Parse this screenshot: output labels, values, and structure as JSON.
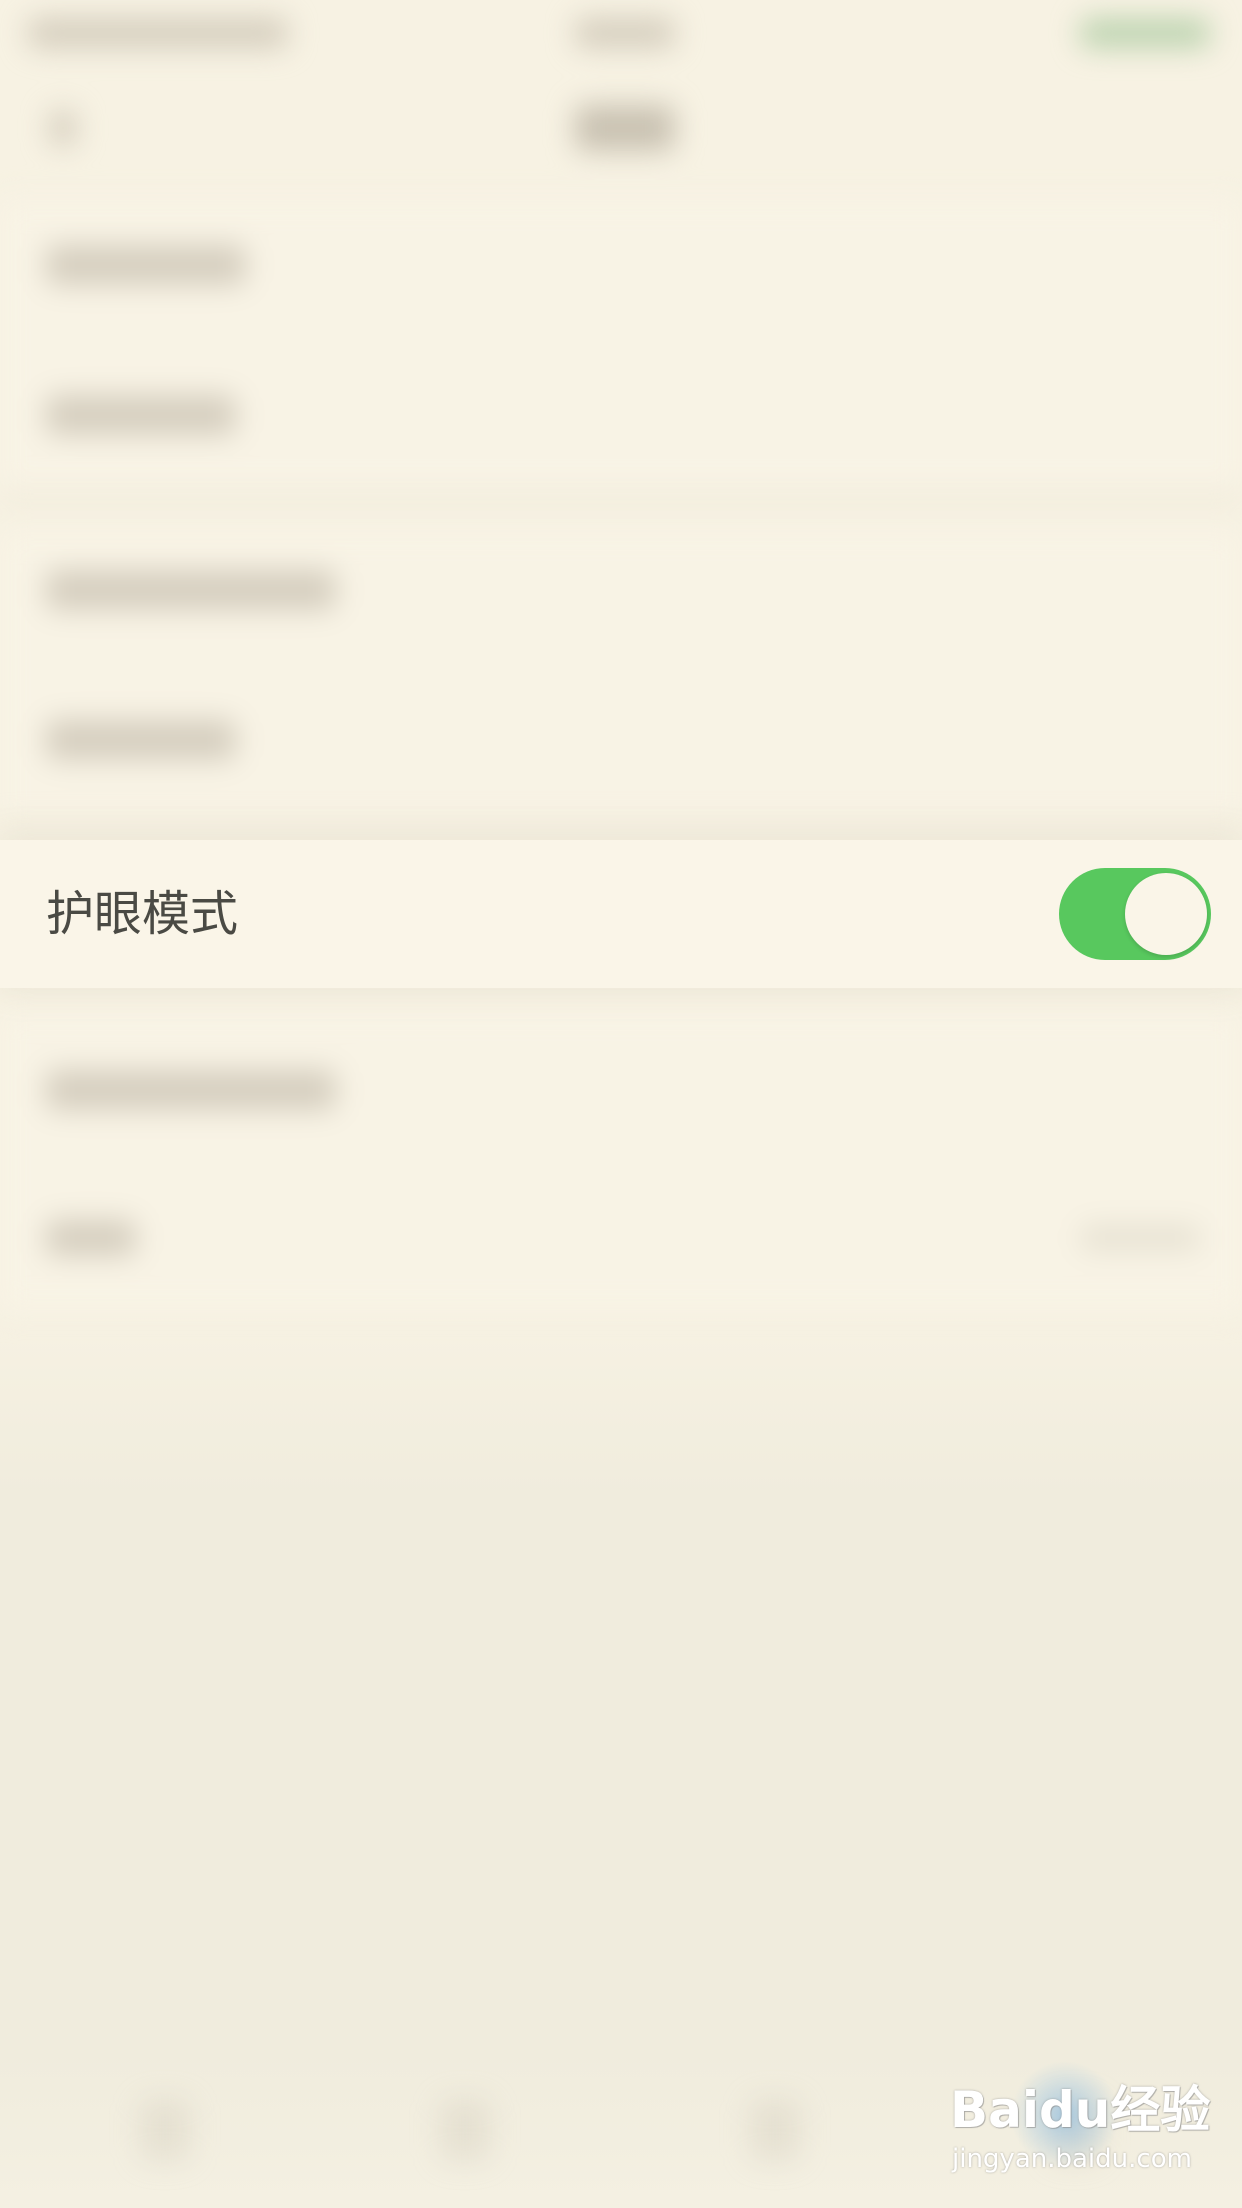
{
  "settings": {
    "eye_care_mode": {
      "label": "护眼模式",
      "enabled": true
    }
  },
  "colors": {
    "toggle_on": "#58c85e",
    "background": "#f7f2e3",
    "row_background": "#faf5e8",
    "label_text": "#4a4a44"
  },
  "icons": {
    "toggle": "toggle-switch-icon"
  },
  "watermark": {
    "logo": "Baidu经验",
    "url": "jingyan.baidu.com"
  }
}
